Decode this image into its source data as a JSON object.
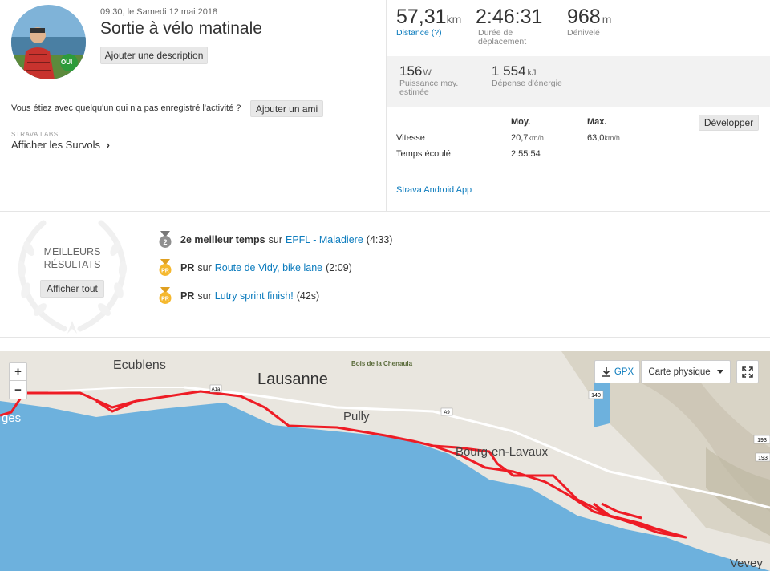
{
  "activity": {
    "date_line": "09:30, le Samedi 12 mai 2018",
    "title": "Sortie à vélo matinale",
    "add_description": "Ajouter une description",
    "avatar_badge": "OUI",
    "ask_text": "Vous étiez avec quelqu'un qui n'a pas enregistré l'activité ?",
    "add_friend": "Ajouter un ami",
    "labs_label": "STRAVA LABS",
    "flyby_label": "Afficher les Survols",
    "flyby_chevron": "›"
  },
  "stats": {
    "distance": {
      "value": "57,31",
      "unit": "km",
      "label": "Distance (?)"
    },
    "moving_time": {
      "value": "2:46:31",
      "label_line1": "Durée de",
      "label_line2": "déplacement"
    },
    "elevation": {
      "value": "968",
      "unit": "m",
      "label": "Dénivelé"
    },
    "power": {
      "value": "156",
      "unit": "W",
      "label_line1": "Puissance moy.",
      "label_line2": "estimée"
    },
    "energy": {
      "value": "1 554",
      "unit": "kJ",
      "label": "Dépense d'énergie"
    }
  },
  "details_table": {
    "headers": {
      "avg": "Moy.",
      "max": "Max."
    },
    "rows": [
      {
        "label": "Vitesse",
        "avg": "20,7",
        "avg_unit": "km/h",
        "max": "63,0",
        "max_unit": "km/h"
      },
      {
        "label": "Temps écoulé",
        "avg": "2:55:54",
        "max": ""
      }
    ],
    "develop_button": "Développer",
    "device": "Strava Android App"
  },
  "achievements": {
    "title_line1": "MEILLEURS",
    "title_line2": "RÉSULTATS",
    "show_all": "Afficher tout",
    "items": [
      {
        "rank_badge": "2",
        "badge_color": "#8f8f8f",
        "rank": "2e meilleur temps",
        "on": "sur",
        "segment": "EPFL - Maladiere",
        "time": "(4:33)"
      },
      {
        "rank_badge": "PR",
        "badge_color": "#f5b82e",
        "rank": "PR",
        "on": "sur",
        "segment": "Route de Vidy, bike lane",
        "time": "(2:09)"
      },
      {
        "rank_badge": "PR",
        "badge_color": "#f5b82e",
        "rank": "PR",
        "on": "sur",
        "segment": "Lutry sprint finish!",
        "time": "(42s)"
      }
    ]
  },
  "map": {
    "zoom_in": "+",
    "zoom_out": "−",
    "gpx_label": "GPX",
    "map_type": "Carte physique",
    "labels": {
      "ecublens": "Ecublens",
      "lausanne": "Lausanne",
      "chenaula": "Bois de la Chenaula",
      "pully": "Pully",
      "bourg": "Bourg-en-Lavaux",
      "vevey": "Vevey",
      "ges": "ges"
    },
    "road_shields": {
      "a1a": "A1a",
      "a9": "A9",
      "r140": "140",
      "r193a": "193",
      "r193b": "193"
    },
    "colors": {
      "lake": "#6db1dd",
      "route": "#ee1c25",
      "land": "#e9e6df"
    }
  }
}
